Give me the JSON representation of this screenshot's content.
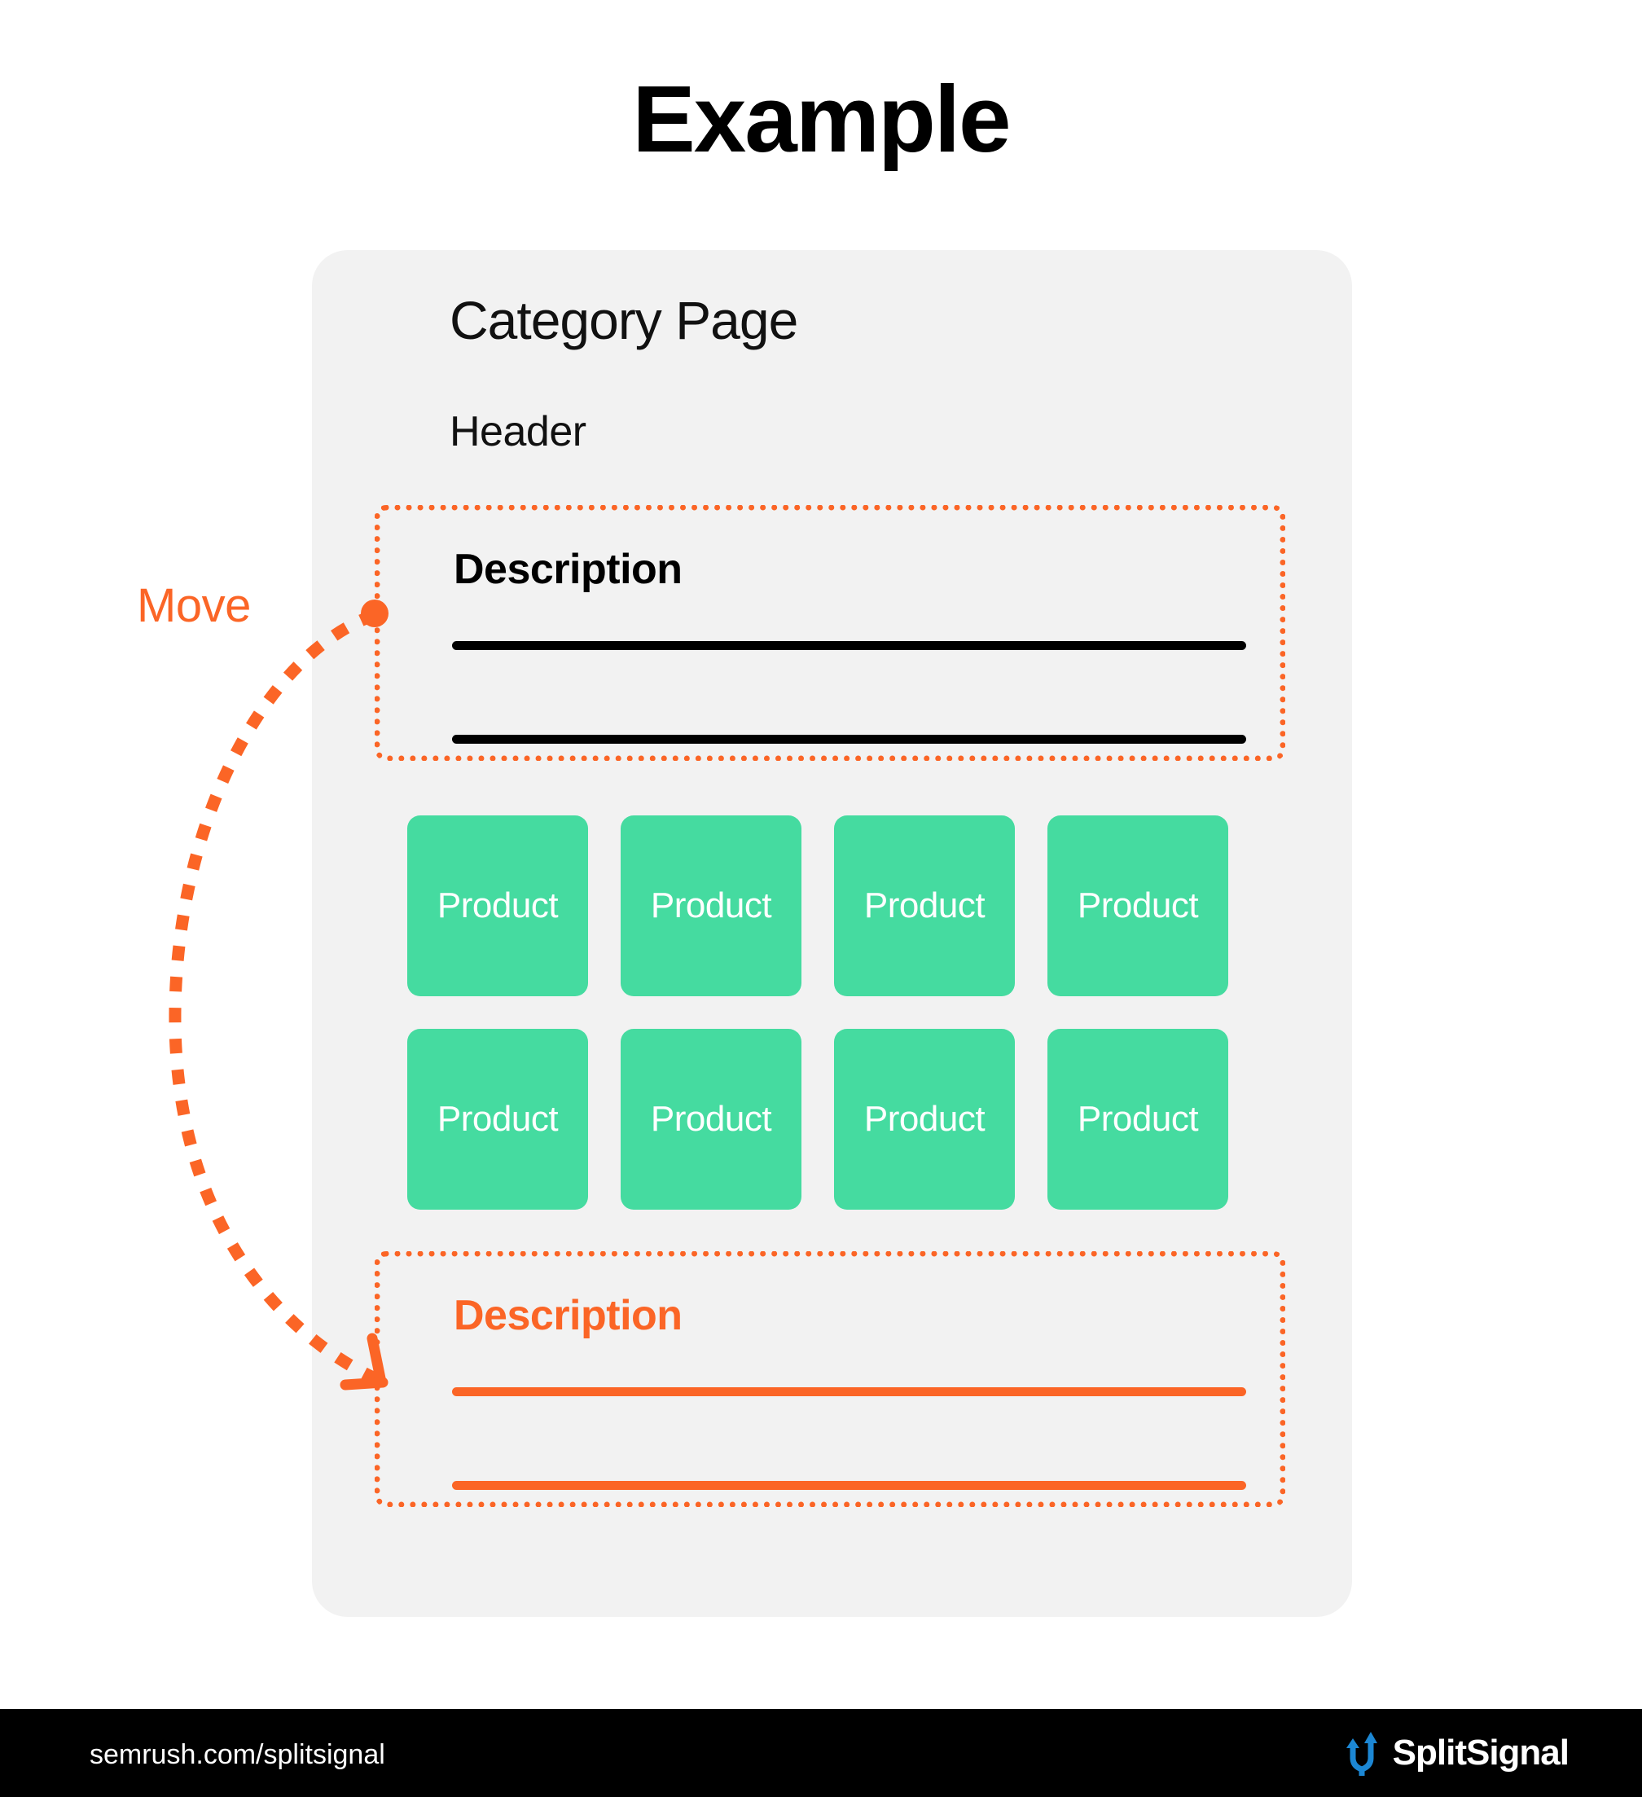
{
  "page": {
    "title": "Example",
    "background_color": "#FFFFFF"
  },
  "colors": {
    "accent_orange": "#FB6526",
    "product_green": "#45DBA0",
    "card_grey": "#F2F2F2",
    "text_black": "#000000",
    "footer_black": "#000000",
    "logo_blue": "#1C87D4"
  },
  "card": {
    "heading": "Category Page",
    "subheading": "Header"
  },
  "annotation": {
    "move_label": "Move",
    "connector_icon": "curved-dotted-arrow-icon",
    "start_marker_icon": "dot-marker-icon",
    "end_marker_icon": "arrowhead-icon"
  },
  "description_original": {
    "title": "Description",
    "lines": 2,
    "style": "black",
    "position": "above-product-grid"
  },
  "description_new": {
    "title": "Description",
    "lines": 2,
    "style": "orange",
    "position": "below-product-grid"
  },
  "product_grid": {
    "rows": 2,
    "columns": 4,
    "tiles": [
      {
        "label": "Product"
      },
      {
        "label": "Product"
      },
      {
        "label": "Product"
      },
      {
        "label": "Product"
      },
      {
        "label": "Product"
      },
      {
        "label": "Product"
      },
      {
        "label": "Product"
      },
      {
        "label": "Product"
      }
    ]
  },
  "footer": {
    "url": "semrush.com/splitsignal",
    "brand_name": "SplitSignal",
    "brand_logo_icon": "split-arrows-logo-icon"
  }
}
